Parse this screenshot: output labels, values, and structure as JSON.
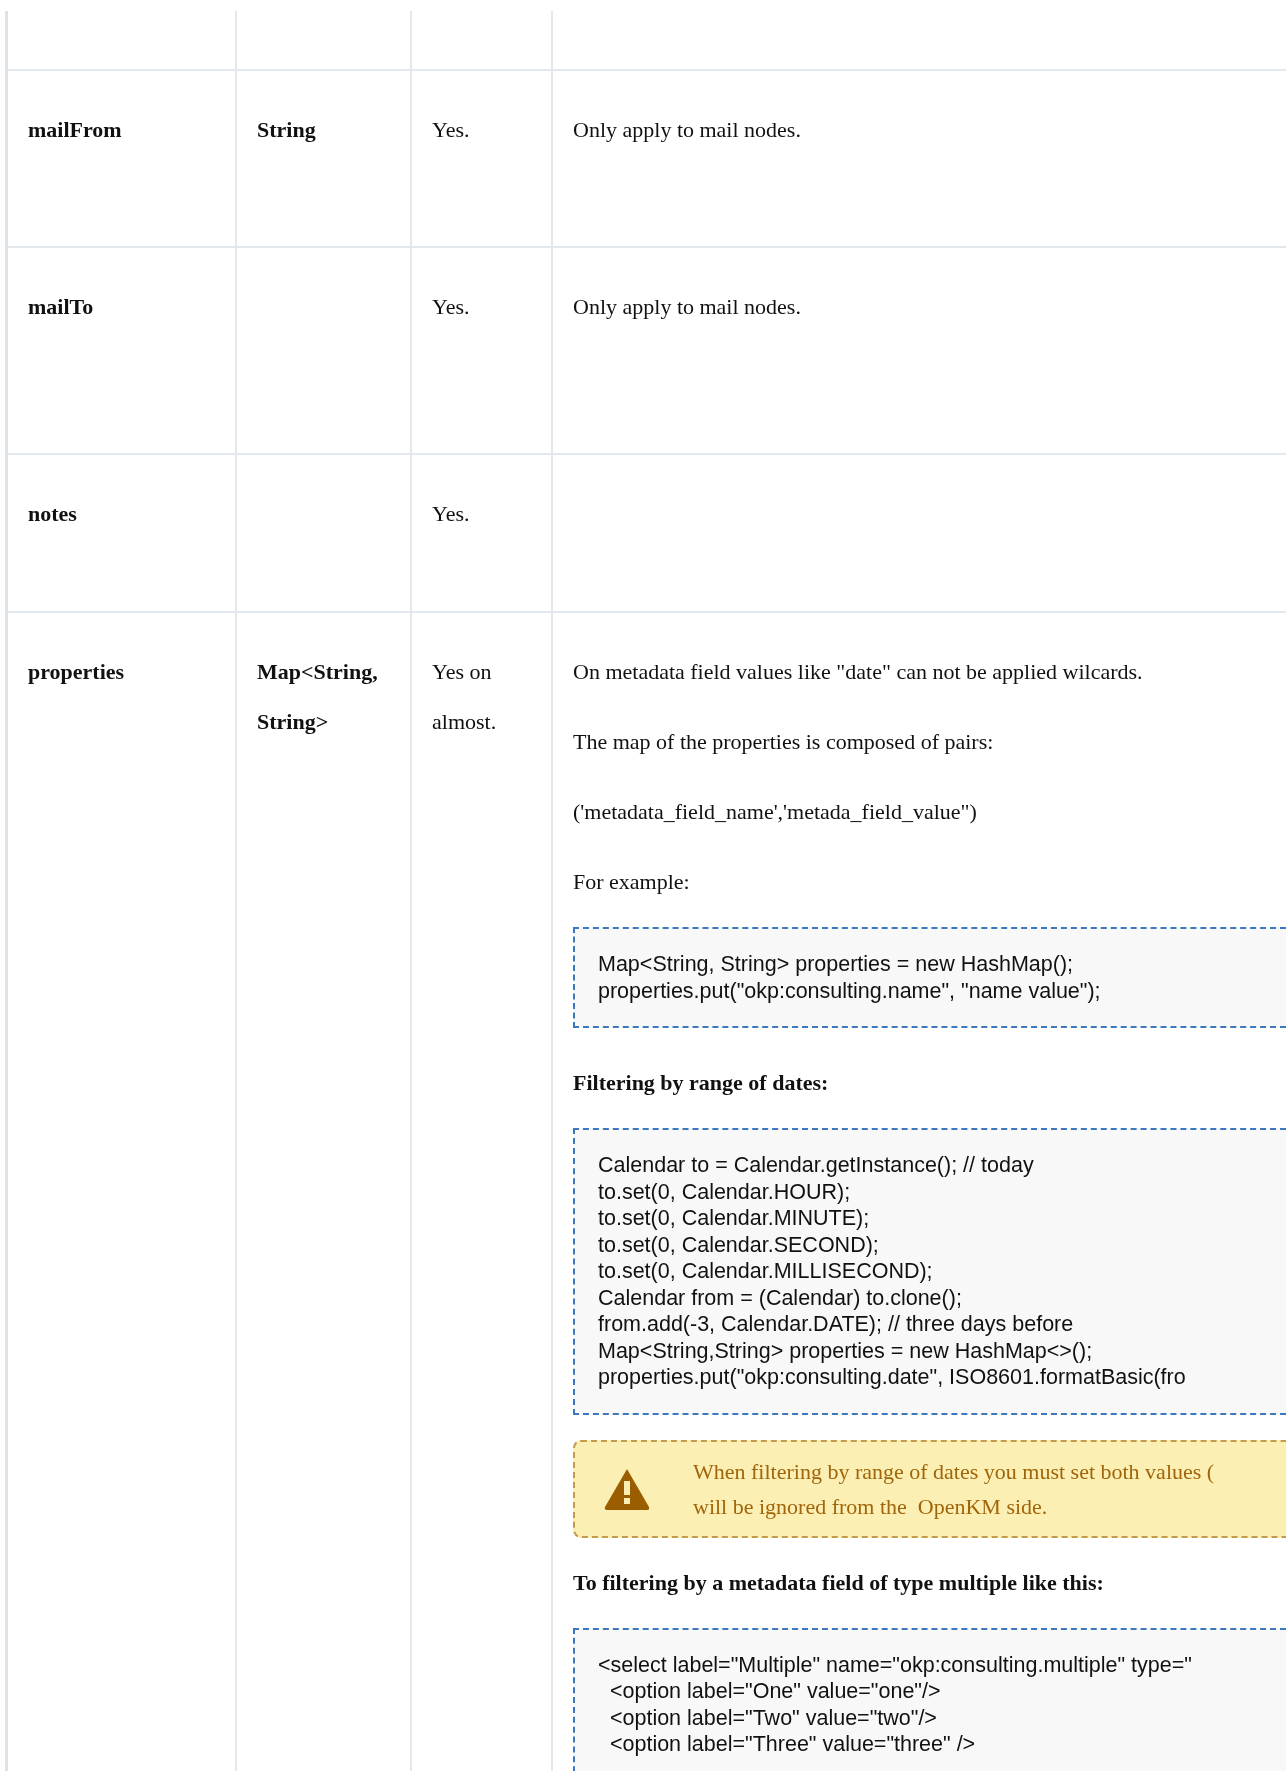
{
  "table": {
    "rows": [
      {
        "name": "mailFrom",
        "type": "String",
        "required": "Yes.",
        "description": [
          {
            "kind": "paragraph",
            "text": "Only apply to mail nodes."
          }
        ]
      },
      {
        "name": "mailTo",
        "required": "Yes.",
        "description": [
          {
            "kind": "paragraph",
            "text": "Only apply to mail nodes."
          }
        ]
      },
      {
        "name": "notes",
        "required": "Yes."
      },
      {
        "name": "properties",
        "type": "Map<String, String>",
        "required": "Yes on almost.",
        "description": [
          {
            "kind": "paragraph",
            "text": "On metadata field values like \"date\" can not be applied wilcards."
          },
          {
            "kind": "paragraph",
            "text": "The map of the properties is composed of pairs:"
          },
          {
            "kind": "paragraph",
            "text": "('metadata_field_name','metada_field_value\")"
          },
          {
            "kind": "paragraph",
            "text": "For example:"
          },
          {
            "kind": "code",
            "lines": [
              "Map<String, String> properties = new HashMap();",
              "properties.put(\"okp:consulting.name\", \"name value\");"
            ]
          },
          {
            "kind": "heading",
            "text": "Filtering by range of dates:"
          },
          {
            "kind": "code",
            "lines": [
              "Calendar to = Calendar.getInstance(); // today",
              "to.set(0, Calendar.HOUR);",
              "to.set(0, Calendar.MINUTE);",
              "to.set(0, Calendar.SECOND);",
              "to.set(0, Calendar.MILLISECOND);",
              "Calendar from = (Calendar) to.clone();",
              "from.add(-3, Calendar.DATE); // three days before",
              "Map<String,String> properties = new HashMap<>();",
              "properties.put(\"okp:consulting.date\", ISO8601.formatBasic(fro"
            ]
          },
          {
            "kind": "warning",
            "lines": [
              "When filtering by range of dates you must set both values (",
              "will be ignored from the  OpenKM side."
            ]
          },
          {
            "kind": "heading",
            "text": "To filtering by a metadata field of type multiple like this:"
          },
          {
            "kind": "code",
            "lines": [
              "<select label=\"Multiple\" name=\"okp:consulting.multiple\" type=\"",
              "  <option label=\"One\" value=\"one\"/>",
              "  <option label=\"Two\" value=\"two\"/>",
              "  <option label=\"Three\" value=\"three\" />"
            ]
          }
        ]
      }
    ]
  }
}
